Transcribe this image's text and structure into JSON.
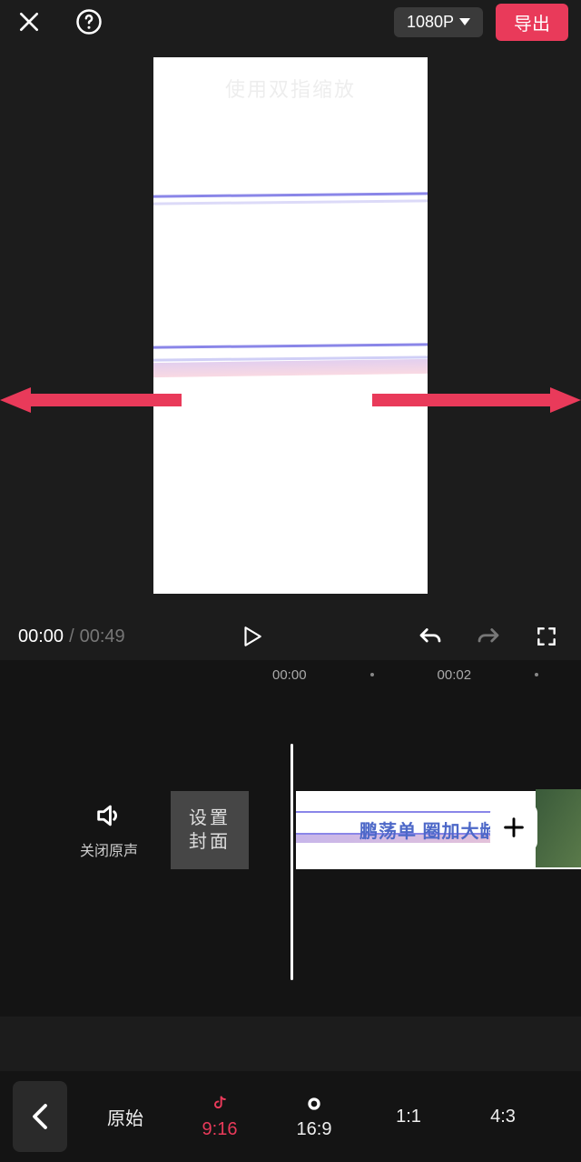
{
  "topbar": {
    "resolution": "1080P",
    "export_label": "导出"
  },
  "preview": {
    "hint": "使用双指缩放"
  },
  "playback": {
    "current": "00:00",
    "separator": "/",
    "total": "00:49"
  },
  "ruler": {
    "t0": "00:00",
    "t1": "00:02"
  },
  "timeline": {
    "mute_label": "关闭原声",
    "cover_label": "设置\n封面",
    "clip_text": "鹏荡单  圈加大龄舞"
  },
  "aspect": {
    "items": [
      {
        "label": "原始"
      },
      {
        "label": "9:16",
        "icon": "douyin",
        "active": true
      },
      {
        "label": "16:9",
        "icon": "xigua"
      },
      {
        "label": "1:1"
      },
      {
        "label": "4:3"
      }
    ]
  }
}
